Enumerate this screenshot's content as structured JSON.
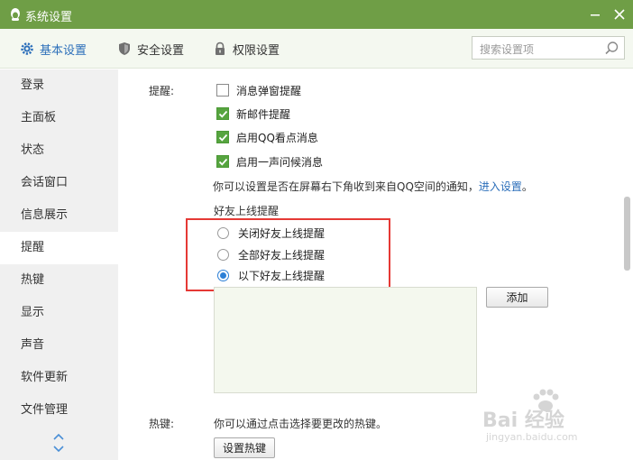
{
  "window": {
    "title": "系统设置"
  },
  "toolbar": {
    "tabs": [
      {
        "label": "基本设置",
        "active": true,
        "icon": "gear-icon"
      },
      {
        "label": "安全设置",
        "active": false,
        "icon": "shield-icon"
      },
      {
        "label": "权限设置",
        "active": false,
        "icon": "lock-icon"
      }
    ],
    "search": {
      "placeholder": "搜索设置项"
    }
  },
  "sidebar": {
    "items": [
      {
        "label": "登录"
      },
      {
        "label": "主面板"
      },
      {
        "label": "状态"
      },
      {
        "label": "会话窗口"
      },
      {
        "label": "信息展示"
      },
      {
        "label": "提醒",
        "active": true
      },
      {
        "label": "热键"
      },
      {
        "label": "显示"
      },
      {
        "label": "声音"
      },
      {
        "label": "软件更新"
      },
      {
        "label": "文件管理"
      }
    ]
  },
  "reminder": {
    "section_label": "提醒:",
    "options": [
      {
        "label": "消息弹窗提醒",
        "checked": false
      },
      {
        "label": "新邮件提醒",
        "checked": true
      },
      {
        "label": "启用QQ看点消息",
        "checked": true
      },
      {
        "label": "启用一声问候消息",
        "checked": true
      }
    ],
    "note_text": "你可以设置是否在屏幕右下角收到来自QQ空间的通知，",
    "note_link": "进入设置",
    "note_end": "。"
  },
  "friend_online": {
    "heading": "好友上线提醒",
    "options": [
      {
        "label": "关闭好友上线提醒",
        "selected": false
      },
      {
        "label": "全部好友上线提醒",
        "selected": false
      },
      {
        "label": "以下好友上线提醒",
        "selected": true
      }
    ],
    "add_button": "添加"
  },
  "hotkey": {
    "section_label": "热键:",
    "description": "你可以通过点击选择要更改的热键。",
    "button": "设置热键"
  },
  "watermark": {
    "brand": "Bai 经验",
    "url": "jingyan.baidu.com"
  },
  "colors": {
    "titlebar": "#6f9e46",
    "accent": "#2c6fba",
    "check": "#56a43f",
    "highlight": "#e53935"
  }
}
